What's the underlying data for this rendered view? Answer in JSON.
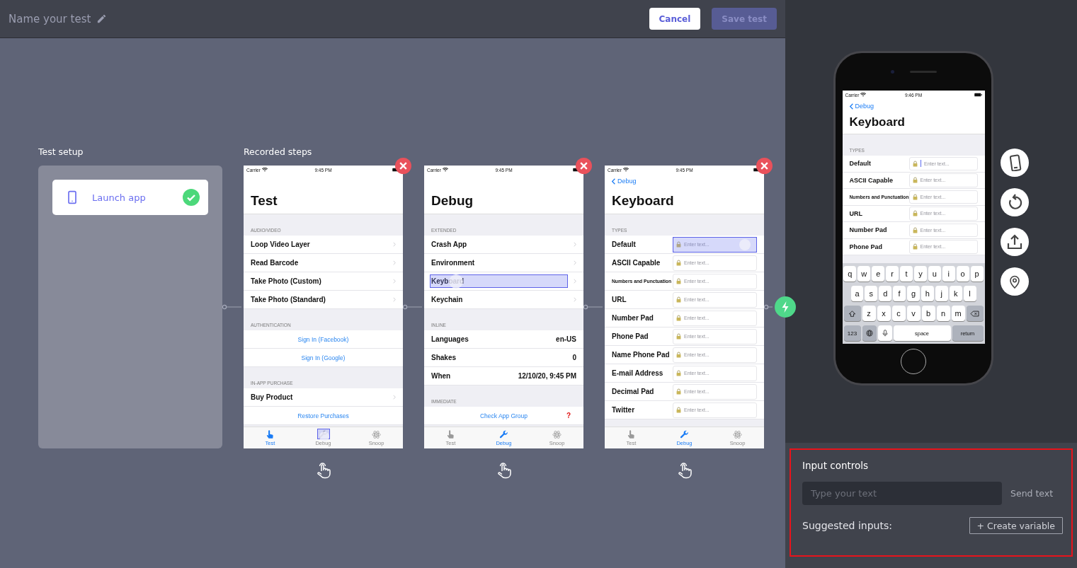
{
  "header": {
    "title": "Name your test",
    "buttons": [
      {
        "label": "Cancel",
        "kind": "secondary",
        "disabled": false
      },
      {
        "label": "Save test",
        "kind": "primary",
        "disabled": true
      }
    ]
  },
  "setup": {
    "title": "Test setup",
    "steps": [
      {
        "label": "Launch app",
        "done": true
      }
    ]
  },
  "recorded": {
    "title": "Recorded steps",
    "steps": [
      {
        "screen": {
          "status": {
            "carrier": "Carrier",
            "time": "9:45 PM"
          },
          "title": "Test",
          "sections": [
            {
              "header": "AUDIO/VIDEO",
              "rows": [
                {
                  "kind": "nav",
                  "label": "Loop Video Layer",
                  "touched": false
                },
                {
                  "kind": "nav",
                  "label": "Read Barcode",
                  "touched": false
                },
                {
                  "kind": "nav",
                  "label": "Take Photo (Custom)",
                  "touched": false
                },
                {
                  "kind": "nav",
                  "label": "Take Photo (Standard)",
                  "touched": false
                }
              ]
            },
            {
              "header": "AUTHENTICATION",
              "rows": [
                {
                  "kind": "link",
                  "label": "Sign In (Facebook)",
                  "touched": false
                },
                {
                  "kind": "link",
                  "label": "Sign In (Google)",
                  "touched": false
                }
              ]
            },
            {
              "header": "IN-APP PURCHASE",
              "rows": [
                {
                  "kind": "nav",
                  "label": "Buy Product",
                  "touched": false
                },
                {
                  "kind": "link",
                  "label": "Restore Purchases",
                  "touched": false
                }
              ]
            }
          ],
          "tabs": [
            {
              "kind": "hand",
              "label": "Test",
              "selected": true,
              "touched": false
            },
            {
              "kind": "wrench",
              "label": "Debug",
              "selected": false,
              "touched": true
            },
            {
              "kind": "atom",
              "label": "Snoop",
              "selected": false,
              "touched": false
            }
          ]
        }
      },
      {
        "screen": {
          "status": {
            "carrier": "Carrier",
            "time": "9:45 PM"
          },
          "title": "Debug",
          "sections": [
            {
              "header": "EXTENDED",
              "rows": [
                {
                  "kind": "nav",
                  "label": "Crash App",
                  "touched": false
                },
                {
                  "kind": "nav",
                  "label": "Environment",
                  "touched": false
                },
                {
                  "kind": "nav",
                  "label": "Keyboard",
                  "touched": true
                },
                {
                  "kind": "nav",
                  "label": "Keychain",
                  "touched": false
                }
              ]
            },
            {
              "header": "INLINE",
              "rows": [
                {
                  "kind": "value",
                  "label": "Languages",
                  "value": "en-US",
                  "touched": false
                },
                {
                  "kind": "value",
                  "label": "Shakes",
                  "value": "0",
                  "touched": false
                },
                {
                  "kind": "value",
                  "label": "When",
                  "value": "12/10/20, 9:45 PM",
                  "touched": false
                }
              ]
            },
            {
              "header": "IMMEDIATE",
              "rows": [
                {
                  "kind": "link",
                  "label": "Check App Group",
                  "badge": "?",
                  "touched": false
                }
              ]
            }
          ],
          "tabs": [
            {
              "kind": "hand",
              "label": "Test",
              "selected": false,
              "touched": false
            },
            {
              "kind": "wrench",
              "label": "Debug",
              "selected": true,
              "touched": false
            },
            {
              "kind": "atom",
              "label": "Snoop",
              "selected": false,
              "touched": false
            }
          ]
        }
      },
      {
        "screen": {
          "status": {
            "carrier": "Carrier",
            "time": "9:45 PM"
          },
          "back": "Debug",
          "title": "Keyboard",
          "sections": [
            {
              "header": "TYPES",
              "rows": [
                {
                  "kind": "field",
                  "label": "Default",
                  "placeholder": "Enter text...",
                  "touched": true
                },
                {
                  "kind": "field",
                  "label": "ASCII Capable",
                  "placeholder": "Enter text...",
                  "touched": false
                },
                {
                  "kind": "field",
                  "label": "Numbers and Punctuation",
                  "placeholder": "Enter text...",
                  "touched": false
                },
                {
                  "kind": "field",
                  "label": "URL",
                  "placeholder": "Enter text...",
                  "touched": false
                },
                {
                  "kind": "field",
                  "label": "Number Pad",
                  "placeholder": "Enter text...",
                  "touched": false
                },
                {
                  "kind": "field",
                  "label": "Phone Pad",
                  "placeholder": "Enter text...",
                  "touched": false
                },
                {
                  "kind": "field",
                  "label": "Name Phone Pad",
                  "placeholder": "Enter text...",
                  "touched": false
                },
                {
                  "kind": "field",
                  "label": "E-mail Address",
                  "placeholder": "Enter text...",
                  "touched": false
                },
                {
                  "kind": "field",
                  "label": "Decimal Pad",
                  "placeholder": "Enter text...",
                  "touched": false
                },
                {
                  "kind": "field",
                  "label": "Twitter",
                  "placeholder": "Enter text...",
                  "touched": false
                }
              ]
            }
          ],
          "tabs": [
            {
              "kind": "hand",
              "label": "Test",
              "selected": false,
              "touched": false
            },
            {
              "kind": "wrench",
              "label": "Debug",
              "selected": true,
              "touched": false
            },
            {
              "kind": "atom",
              "label": "Snoop",
              "selected": false,
              "touched": false
            }
          ]
        }
      }
    ]
  },
  "device": {
    "screen": {
      "status": {
        "carrier": "Carrier",
        "time": "9:46 PM"
      },
      "back": "Debug",
      "title": "Keyboard",
      "sections": [
        {
          "header": "TYPES",
          "rows": [
            {
              "kind": "field",
              "label": "Default",
              "placeholder": "Enter text...",
              "focused": true
            },
            {
              "kind": "field",
              "label": "ASCII Capable",
              "placeholder": "Enter text...",
              "focused": false
            },
            {
              "kind": "field",
              "label": "Numbers and Punctuation",
              "placeholder": "Enter text...",
              "focused": false
            },
            {
              "kind": "field",
              "label": "URL",
              "placeholder": "Enter text...",
              "focused": false
            },
            {
              "kind": "field",
              "label": "Number Pad",
              "placeholder": "Enter text...",
              "focused": false
            },
            {
              "kind": "field",
              "label": "Phone Pad",
              "placeholder": "Enter text...",
              "focused": false
            }
          ]
        }
      ],
      "keyboard": {
        "rows": [
          {
            "keys": [
              "q",
              "w",
              "e",
              "r",
              "t",
              "y",
              "u",
              "i",
              "o",
              "p"
            ]
          },
          {
            "keys": [
              "a",
              "s",
              "d",
              "f",
              "g",
              "h",
              "j",
              "k",
              "l"
            ]
          },
          {
            "keys": [
              {
                "kind": "shift"
              },
              "z",
              "x",
              "c",
              "v",
              "b",
              "n",
              "m",
              {
                "kind": "delete"
              }
            ]
          },
          {
            "keys": [
              {
                "kind": "mode",
                "label": "123"
              },
              {
                "kind": "globe"
              },
              {
                "kind": "mic"
              },
              {
                "kind": "space",
                "label": "space"
              },
              {
                "kind": "return",
                "label": "return"
              }
            ]
          }
        ]
      }
    }
  },
  "input_controls": {
    "title": "Input controls",
    "placeholder": "Type your text",
    "send_label": "Send text",
    "suggested_label": "Suggested inputs:",
    "create_label": "+ Create variable"
  }
}
